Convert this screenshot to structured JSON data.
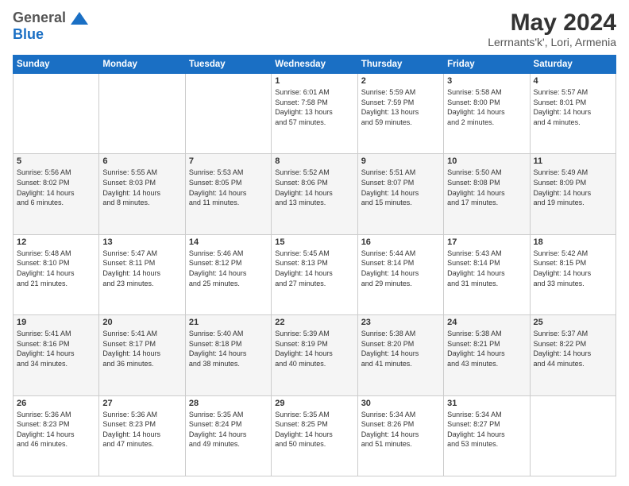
{
  "logo": {
    "line1": "General",
    "line2": "Blue"
  },
  "title": "May 2024",
  "subtitle": "Lerrnants'k', Lori, Armenia",
  "headers": [
    "Sunday",
    "Monday",
    "Tuesday",
    "Wednesday",
    "Thursday",
    "Friday",
    "Saturday"
  ],
  "weeks": [
    [
      {
        "day": "",
        "info": ""
      },
      {
        "day": "",
        "info": ""
      },
      {
        "day": "",
        "info": ""
      },
      {
        "day": "1",
        "info": "Sunrise: 6:01 AM\nSunset: 7:58 PM\nDaylight: 13 hours\nand 57 minutes."
      },
      {
        "day": "2",
        "info": "Sunrise: 5:59 AM\nSunset: 7:59 PM\nDaylight: 13 hours\nand 59 minutes."
      },
      {
        "day": "3",
        "info": "Sunrise: 5:58 AM\nSunset: 8:00 PM\nDaylight: 14 hours\nand 2 minutes."
      },
      {
        "day": "4",
        "info": "Sunrise: 5:57 AM\nSunset: 8:01 PM\nDaylight: 14 hours\nand 4 minutes."
      }
    ],
    [
      {
        "day": "5",
        "info": "Sunrise: 5:56 AM\nSunset: 8:02 PM\nDaylight: 14 hours\nand 6 minutes."
      },
      {
        "day": "6",
        "info": "Sunrise: 5:55 AM\nSunset: 8:03 PM\nDaylight: 14 hours\nand 8 minutes."
      },
      {
        "day": "7",
        "info": "Sunrise: 5:53 AM\nSunset: 8:05 PM\nDaylight: 14 hours\nand 11 minutes."
      },
      {
        "day": "8",
        "info": "Sunrise: 5:52 AM\nSunset: 8:06 PM\nDaylight: 14 hours\nand 13 minutes."
      },
      {
        "day": "9",
        "info": "Sunrise: 5:51 AM\nSunset: 8:07 PM\nDaylight: 14 hours\nand 15 minutes."
      },
      {
        "day": "10",
        "info": "Sunrise: 5:50 AM\nSunset: 8:08 PM\nDaylight: 14 hours\nand 17 minutes."
      },
      {
        "day": "11",
        "info": "Sunrise: 5:49 AM\nSunset: 8:09 PM\nDaylight: 14 hours\nand 19 minutes."
      }
    ],
    [
      {
        "day": "12",
        "info": "Sunrise: 5:48 AM\nSunset: 8:10 PM\nDaylight: 14 hours\nand 21 minutes."
      },
      {
        "day": "13",
        "info": "Sunrise: 5:47 AM\nSunset: 8:11 PM\nDaylight: 14 hours\nand 23 minutes."
      },
      {
        "day": "14",
        "info": "Sunrise: 5:46 AM\nSunset: 8:12 PM\nDaylight: 14 hours\nand 25 minutes."
      },
      {
        "day": "15",
        "info": "Sunrise: 5:45 AM\nSunset: 8:13 PM\nDaylight: 14 hours\nand 27 minutes."
      },
      {
        "day": "16",
        "info": "Sunrise: 5:44 AM\nSunset: 8:14 PM\nDaylight: 14 hours\nand 29 minutes."
      },
      {
        "day": "17",
        "info": "Sunrise: 5:43 AM\nSunset: 8:14 PM\nDaylight: 14 hours\nand 31 minutes."
      },
      {
        "day": "18",
        "info": "Sunrise: 5:42 AM\nSunset: 8:15 PM\nDaylight: 14 hours\nand 33 minutes."
      }
    ],
    [
      {
        "day": "19",
        "info": "Sunrise: 5:41 AM\nSunset: 8:16 PM\nDaylight: 14 hours\nand 34 minutes."
      },
      {
        "day": "20",
        "info": "Sunrise: 5:41 AM\nSunset: 8:17 PM\nDaylight: 14 hours\nand 36 minutes."
      },
      {
        "day": "21",
        "info": "Sunrise: 5:40 AM\nSunset: 8:18 PM\nDaylight: 14 hours\nand 38 minutes."
      },
      {
        "day": "22",
        "info": "Sunrise: 5:39 AM\nSunset: 8:19 PM\nDaylight: 14 hours\nand 40 minutes."
      },
      {
        "day": "23",
        "info": "Sunrise: 5:38 AM\nSunset: 8:20 PM\nDaylight: 14 hours\nand 41 minutes."
      },
      {
        "day": "24",
        "info": "Sunrise: 5:38 AM\nSunset: 8:21 PM\nDaylight: 14 hours\nand 43 minutes."
      },
      {
        "day": "25",
        "info": "Sunrise: 5:37 AM\nSunset: 8:22 PM\nDaylight: 14 hours\nand 44 minutes."
      }
    ],
    [
      {
        "day": "26",
        "info": "Sunrise: 5:36 AM\nSunset: 8:23 PM\nDaylight: 14 hours\nand 46 minutes."
      },
      {
        "day": "27",
        "info": "Sunrise: 5:36 AM\nSunset: 8:23 PM\nDaylight: 14 hours\nand 47 minutes."
      },
      {
        "day": "28",
        "info": "Sunrise: 5:35 AM\nSunset: 8:24 PM\nDaylight: 14 hours\nand 49 minutes."
      },
      {
        "day": "29",
        "info": "Sunrise: 5:35 AM\nSunset: 8:25 PM\nDaylight: 14 hours\nand 50 minutes."
      },
      {
        "day": "30",
        "info": "Sunrise: 5:34 AM\nSunset: 8:26 PM\nDaylight: 14 hours\nand 51 minutes."
      },
      {
        "day": "31",
        "info": "Sunrise: 5:34 AM\nSunset: 8:27 PM\nDaylight: 14 hours\nand 53 minutes."
      },
      {
        "day": "",
        "info": ""
      }
    ]
  ]
}
